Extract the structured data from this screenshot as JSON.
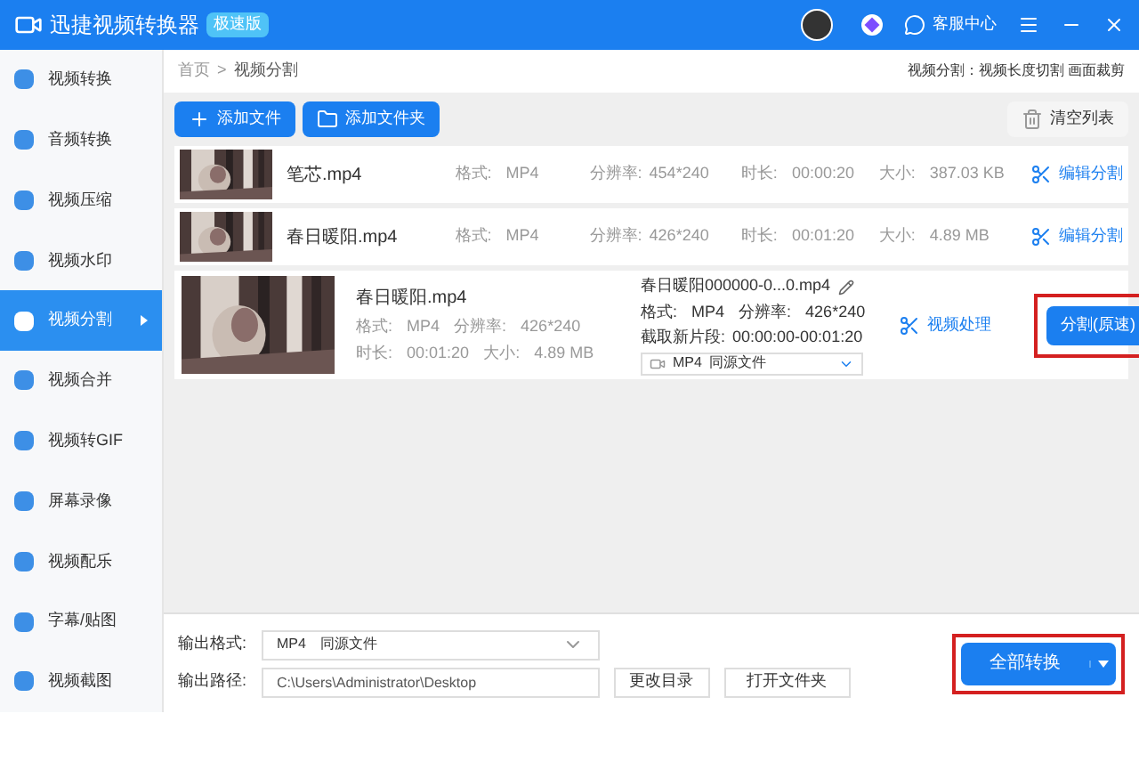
{
  "window": {
    "app_name": "迅捷视频转换器",
    "edition_badge": "极速版",
    "support": "客服中心"
  },
  "sidebar": {
    "items": [
      {
        "label": "视频转换",
        "selected": false
      },
      {
        "label": "音频转换",
        "selected": false
      },
      {
        "label": "视频压缩",
        "selected": false
      },
      {
        "label": "视频水印",
        "selected": false
      },
      {
        "label": "视频分割",
        "selected": true
      },
      {
        "label": "视频合并",
        "selected": false
      },
      {
        "label": "视频转GIF",
        "selected": false
      },
      {
        "label": "屏幕录像",
        "selected": false
      },
      {
        "label": "视频配乐",
        "selected": false
      },
      {
        "label": "字幕/贴图",
        "selected": false
      },
      {
        "label": "视频截图",
        "selected": false
      }
    ]
  },
  "breadcrumb": {
    "home": "首页",
    "separator": ">",
    "current": "视频分割",
    "hint": "视频分割：视频长度切割 画面裁剪"
  },
  "toolbar": {
    "add_file": "添加文件",
    "add_folder": "添加文件夹",
    "clear": "清空列表"
  },
  "files": [
    {
      "name": "笔芯.mp4",
      "format_label": "格式:",
      "format": "MP4",
      "resolution_label": "分辨率:",
      "resolution": "454*240",
      "duration_label": "时长:",
      "duration": "00:00:20",
      "size_label": "大小:",
      "size": "387.03 KB",
      "action": "编辑分割"
    },
    {
      "name": "春日暖阳.mp4",
      "format_label": "格式:",
      "format": "MP4",
      "resolution_label": "分辨率:",
      "resolution": "426*240",
      "duration_label": "时长:",
      "duration": "00:01:20",
      "size_label": "大小:",
      "size": "4.89 MB",
      "action": "编辑分割"
    }
  ],
  "expanded_file": {
    "name": "春日暖阳.mp4",
    "format_label": "格式:",
    "format": "MP4",
    "resolution_label": "分辨率:",
    "resolution": "426*240",
    "duration_label": "时长:",
    "duration": "00:01:20",
    "size_label": "大小:",
    "size": "4.89 MB",
    "output_name": "春日暖阳000000-0...0.mp4",
    "out_format_label": "格式:",
    "out_format": "MP4",
    "out_resolution_label": "分辨率:",
    "out_resolution": "426*240",
    "clip_label": "截取新片段:",
    "clip": "00:00:00-00:01:20",
    "out_select_format": "MP4",
    "out_select_option": "同源文件",
    "process": "视频处理",
    "split_button": "分割(原速)",
    "highlighted": true
  },
  "output": {
    "format_label": "输出格式:",
    "format": "MP4",
    "format_option": "同源文件",
    "path_label": "输出路径:",
    "path": "C:\\Users\\Administrator\\Desktop",
    "change_dir": "更改目录",
    "open_folder": "打开文件夹",
    "convert_all": "全部转换",
    "highlighted": true
  }
}
